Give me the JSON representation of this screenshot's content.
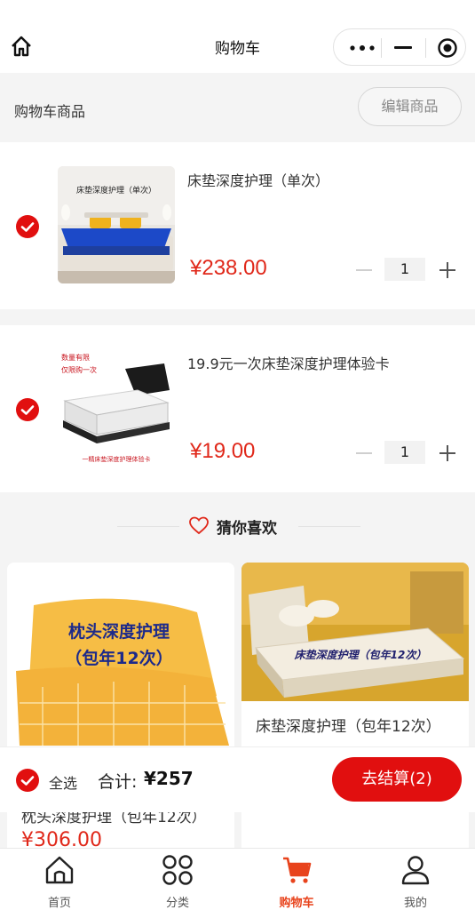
{
  "nav": {
    "title": "购物车"
  },
  "header": {
    "section_title": "购物车商品",
    "edit_label": "编辑商品"
  },
  "cart": {
    "items": [
      {
        "title": "床垫深度护理（单次）",
        "price": "¥238.00",
        "quantity": "1",
        "checked": true,
        "image_text": "床垫深度护理（单次）"
      },
      {
        "title": "19.9元一次床垫深度护理体验卡",
        "price": "¥19.00",
        "quantity": "1",
        "checked": true,
        "image_text": [
          "数量有限",
          "仅限购一次",
          "一精床垫深度护理体验卡"
        ]
      }
    ]
  },
  "recommend": {
    "heading": "猜你喜欢",
    "items": [
      {
        "title": "枕头深度护理（包年12次）",
        "price": "¥306.00",
        "image_text": [
          "枕头深度护理",
          "（包年12次）"
        ]
      },
      {
        "title": "床垫深度护理（包年12次）",
        "image_text": "床垫深度护理（包年12次）"
      }
    ]
  },
  "footer": {
    "select_all": "全选",
    "total_label": "合计:",
    "total_value": "¥257",
    "checkout_label": "去结算(2)"
  },
  "tabbar": {
    "items": [
      {
        "label": "首页",
        "icon": "home-icon"
      },
      {
        "label": "分类",
        "icon": "category-icon"
      },
      {
        "label": "购物车",
        "icon": "cart-icon",
        "active": true
      },
      {
        "label": "我的",
        "icon": "user-icon"
      }
    ]
  },
  "colors": {
    "accent": "#e10f0f",
    "price": "#e0281a",
    "tab_active": "#e8431c"
  }
}
